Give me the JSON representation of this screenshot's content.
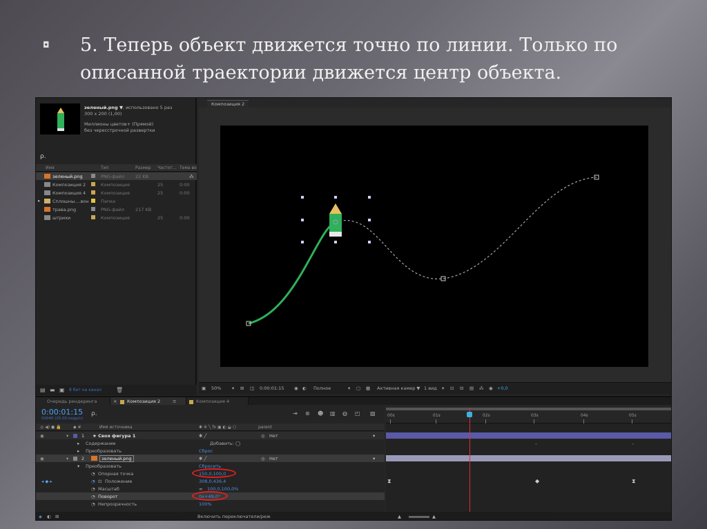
{
  "slide": {
    "bullet": "◘",
    "text": "5. Теперь объект движется точно по линии. Только по описанной траектории движется центр объекта."
  },
  "colors": {
    "path_green": "#2fb05a",
    "timecode_blue": "#4fa0ff",
    "highlight_red": "#e02020",
    "timeline_bar_blue": "#5a5aa8"
  },
  "project": {
    "file_name": "зеленый.png ▼",
    "file_usage": ", использовано 5 раз",
    "file_dims": "300 x 200 (1,00)",
    "file_color": "Миллионы цветов+ (Прямой)",
    "file_interlace": "без чересстрочной развертки",
    "search_icon": "search-icon",
    "search_glyph": "ρ.",
    "columns": [
      "Имя",
      "Тип",
      "Размер",
      "Частот...",
      "Тема во"
    ],
    "items": [
      {
        "name": "зеленый.png",
        "type": "PNG-файл",
        "size": "22 KB",
        "fps": "",
        "icon": "png",
        "swatch": "#8a8a8a",
        "selected": true
      },
      {
        "name": "Композиция 2",
        "type": "Композиция",
        "size": "",
        "fps": "25",
        "dur": "0:00",
        "icon": "comp",
        "swatch": "#c8a850"
      },
      {
        "name": "Композиция 4",
        "type": "Композиция",
        "size": "",
        "fps": "25",
        "dur": "0:00",
        "icon": "comp",
        "swatch": "#c8a850"
      },
      {
        "name": "Сплошны....вон",
        "type": "Папка",
        "size": "",
        "fps": "",
        "icon": "folder",
        "swatch": "#e0c840"
      },
      {
        "name": "трава.png",
        "type": "PNG-файл",
        "size": "217 KB",
        "fps": "",
        "icon": "png",
        "swatch": "#8a8a8a"
      },
      {
        "name": "штрихи",
        "type": "Композиция",
        "size": "",
        "fps": "25",
        "dur": "0:00",
        "icon": "comp",
        "swatch": "#c8a850"
      }
    ],
    "bottom_label": "8 бит на канал"
  },
  "viewer": {
    "tab": "Композиция 2",
    "zoom": "50%",
    "timecode": "0:00:01:15",
    "quality": "Полное",
    "camera": "Активная камер ▼",
    "views": "1 вид",
    "exposure": "+0,0"
  },
  "timeline": {
    "tabs": [
      "Очередь рендеринга",
      "Композиция 2",
      "Композиция 4"
    ],
    "timecode": "0:00:01:15",
    "fps_label": "00040 (25.00 кадр/с)",
    "search_glyph": "ρ.",
    "header": {
      "source": "Имя источника",
      "parent": "parent"
    },
    "rows": [
      {
        "kind": "layer",
        "num": "1",
        "name": "★ Своя фигура 1",
        "parent": "Нет"
      },
      {
        "kind": "prop",
        "name": "Содержание",
        "value": "Добавить: ◯",
        "indent": 1
      },
      {
        "kind": "prop",
        "name": "Преобразовать",
        "value": "Сброс",
        "indent": 1
      },
      {
        "kind": "layer",
        "num": "2",
        "name": "зеленый.png",
        "parent": "Нет",
        "selected": true
      },
      {
        "kind": "prop",
        "name": "Преобразовать",
        "value": "Сбросить",
        "indent": 1
      },
      {
        "kind": "prop",
        "name": "Опорная точка",
        "value": "150,0,100,0",
        "indent": 2,
        "circled": true
      },
      {
        "kind": "prop",
        "name": "Положение",
        "value": "308,0,436,4",
        "indent": 2
      },
      {
        "kind": "prop",
        "name": "Масштаб",
        "value": "100,0,100,0%",
        "indent": 2
      },
      {
        "kind": "prop",
        "name": "Поворот",
        "value": "0x+49,0°",
        "indent": 2,
        "circled": true,
        "selected": true
      },
      {
        "kind": "prop",
        "name": "Непрозрачность",
        "value": "100%",
        "indent": 2
      }
    ],
    "ruler_labels": [
      "00s",
      "01s",
      "02s",
      "03s",
      "04s",
      "05s"
    ],
    "bottom_label": "Включить переключатели/реж"
  }
}
